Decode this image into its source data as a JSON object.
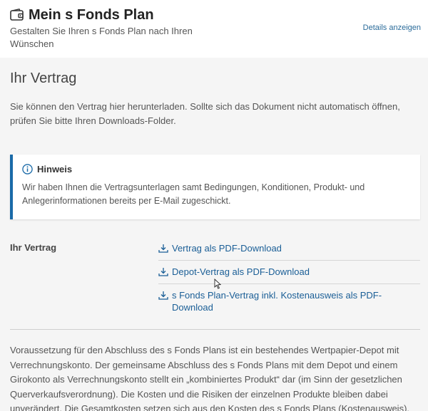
{
  "header": {
    "title": "Mein s Fonds Plan",
    "subtitle": "Gestalten Sie Ihren s Fonds Plan nach Ihren Wünschen",
    "details_link": "Details anzeigen",
    "icon": "wallet-icon"
  },
  "section": {
    "title": "Ihr Vertrag",
    "intro": "Sie können den Vertrag hier herunterladen. Sollte sich das Dokument nicht automatisch öffnen, prüfen Sie bitte Ihren Downloads-Folder."
  },
  "notice": {
    "icon": "info-icon",
    "title": "Hinweis",
    "text": "Wir haben Ihnen die Vertragsunterlagen samt Bedingungen, Konditionen, Produkt- und Anlegerinformationen bereits per E-Mail zugeschickt.",
    "accent_color": "#1a6aa8"
  },
  "contract": {
    "label": "Ihr Vertrag",
    "downloads": [
      {
        "label": "Vertrag als PDF-Download",
        "icon": "download-icon"
      },
      {
        "label": "Depot-Vertrag als PDF-Download",
        "icon": "download-icon"
      },
      {
        "label": "s Fonds Plan-Vertrag inkl. Kostenausweis als PDF-Download",
        "icon": "download-icon"
      }
    ]
  },
  "footer": {
    "text": "Voraussetzung für den Abschluss des s Fonds Plans ist ein bestehendes Wertpapier-Depot mit Verrechnungskonto. Der gemeinsame Abschluss des s Fonds Plans mit dem Depot und einem Girokonto als Verrechnungskonto stellt ein „kombiniertes Produkt“ dar (im Sinn der gesetzlichen Querverkaufsverordnung). Die Kosten und die Risiken der einzelnen Produkte bleiben dabei unverändert. Die Gesamtkosten setzen sich aus den Kosten des s Fonds Plans (Kostenausweis),"
  },
  "colors": {
    "link": "#1a5e96",
    "background": "#f5f5f5"
  }
}
